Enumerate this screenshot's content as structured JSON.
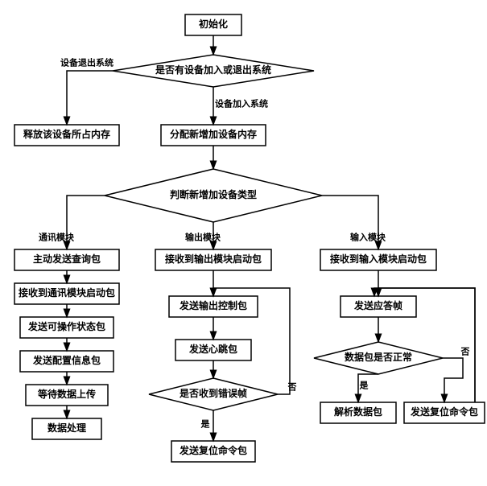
{
  "chart_data": {
    "type": "flowchart",
    "nodes": [
      {
        "id": "init",
        "kind": "process",
        "label": "初始化"
      },
      {
        "id": "exitcheck",
        "kind": "decision",
        "label": "是否有设备加入或退出系统"
      },
      {
        "id": "release",
        "kind": "process",
        "label": "释放该设备所占内存"
      },
      {
        "id": "allocate",
        "kind": "process",
        "label": "分配新增加设备内存"
      },
      {
        "id": "judge",
        "kind": "decision",
        "label": "判断新增加设备类型"
      },
      {
        "id": "comm1",
        "kind": "process",
        "label": "主动发送查询包"
      },
      {
        "id": "comm2",
        "kind": "process",
        "label": "接收到通讯模块启动包"
      },
      {
        "id": "comm3",
        "kind": "process",
        "label": "发送可操作状态包"
      },
      {
        "id": "comm4",
        "kind": "process",
        "label": "发送配置信息包"
      },
      {
        "id": "comm5",
        "kind": "process",
        "label": "等待数据上传"
      },
      {
        "id": "comm6",
        "kind": "process",
        "label": "数据处理"
      },
      {
        "id": "out1",
        "kind": "process",
        "label": "接收到输出模块启动包"
      },
      {
        "id": "out2",
        "kind": "process",
        "label": "发送输出控制包"
      },
      {
        "id": "out3",
        "kind": "process",
        "label": "发送心跳包"
      },
      {
        "id": "outcheck",
        "kind": "decision",
        "label": "是否收到错误帧"
      },
      {
        "id": "out4",
        "kind": "process",
        "label": "发送复位命令包"
      },
      {
        "id": "in1",
        "kind": "process",
        "label": "接收到输入模块启动包"
      },
      {
        "id": "in2",
        "kind": "process",
        "label": "发送应答帧"
      },
      {
        "id": "incheck",
        "kind": "decision",
        "label": "数据包是否正常"
      },
      {
        "id": "in3",
        "kind": "process",
        "label": "解析数据包"
      },
      {
        "id": "in4",
        "kind": "process",
        "label": "发送复位命令包"
      }
    ],
    "edges": [
      {
        "from": "init",
        "to": "exitcheck"
      },
      {
        "from": "exitcheck",
        "to": "release",
        "label": "设备退出系统"
      },
      {
        "from": "exitcheck",
        "to": "allocate",
        "label": "设备加入系统"
      },
      {
        "from": "allocate",
        "to": "judge"
      },
      {
        "from": "judge",
        "to": "comm1",
        "label": "通讯模块"
      },
      {
        "from": "judge",
        "to": "out1",
        "label": "输出模块"
      },
      {
        "from": "judge",
        "to": "in1",
        "label": "输入模块"
      },
      {
        "from": "comm1",
        "to": "comm2"
      },
      {
        "from": "comm2",
        "to": "comm3"
      },
      {
        "from": "comm3",
        "to": "comm4"
      },
      {
        "from": "comm4",
        "to": "comm5"
      },
      {
        "from": "comm5",
        "to": "comm6"
      },
      {
        "from": "out1",
        "to": "out2"
      },
      {
        "from": "out2",
        "to": "out3"
      },
      {
        "from": "out3",
        "to": "outcheck"
      },
      {
        "from": "outcheck",
        "to": "out4",
        "label": "是"
      },
      {
        "from": "outcheck",
        "to": "out2",
        "label": "否"
      },
      {
        "from": "in1",
        "to": "in2"
      },
      {
        "from": "in2",
        "to": "incheck"
      },
      {
        "from": "incheck",
        "to": "in3",
        "label": "是"
      },
      {
        "from": "incheck",
        "to": "in4",
        "label": "否"
      },
      {
        "from": "in4",
        "to": "in2"
      }
    ],
    "edge_labels": {
      "exit_left": "设备退出系统",
      "exit_down": "设备加入系统",
      "branch_comm": "通讯模块",
      "branch_out": "输出模块",
      "branch_in": "输入模块",
      "yes": "是",
      "no": "否"
    }
  }
}
